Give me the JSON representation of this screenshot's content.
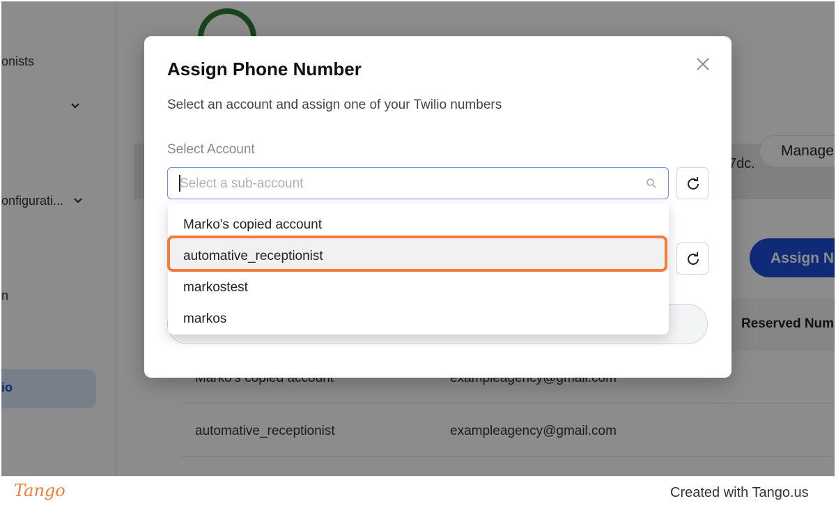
{
  "sidebar": {
    "items": [
      {
        "label": "onists"
      },
      {
        "label": ""
      },
      {
        "label": "onfigurati..."
      },
      {
        "label": "n"
      }
    ],
    "active_label": "io"
  },
  "background": {
    "suffix_text": "7dc.",
    "manage_button": "Manage",
    "assign_new_button": "Assign Ne",
    "table_header": "Reserved Numb",
    "rows": [
      {
        "account": "Marko's copied account",
        "email": "exampleagency@gmail.com"
      },
      {
        "account": "automative_receptionist",
        "email": "exampleagency@gmail.com"
      }
    ]
  },
  "modal": {
    "title": "Assign Phone Number",
    "subtitle": "Select an account and assign one of your Twilio numbers",
    "field_label": "Select Account",
    "select_placeholder": "Select a sub-account",
    "options": [
      "Marko's copied account",
      "automative_receptionist",
      "markostest",
      "markos"
    ],
    "highlighted_option_index": 1
  },
  "footer": {
    "logo_text": "Tango",
    "credit": "Created with Tango.us"
  },
  "colors": {
    "accent_blue": "#1d4ed8",
    "highlight_orange": "#f47b3c"
  }
}
